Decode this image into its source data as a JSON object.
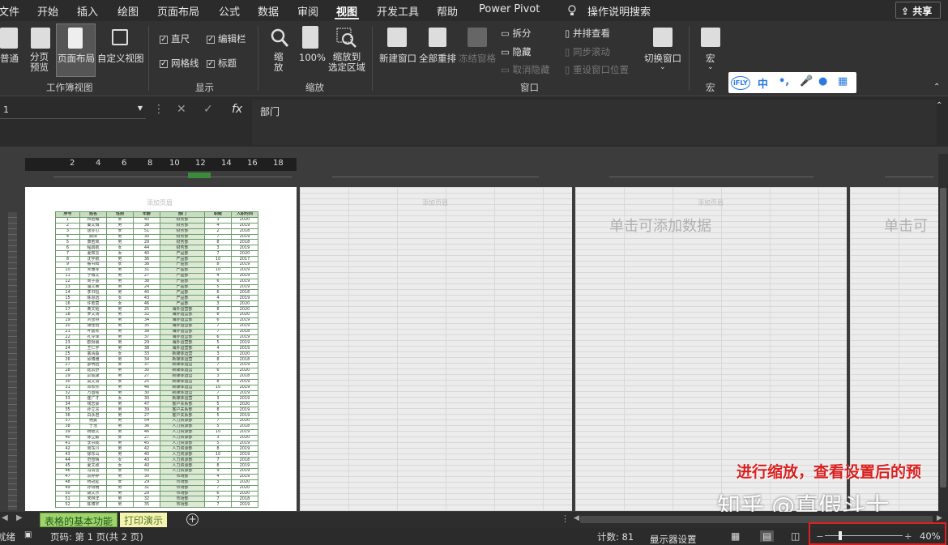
{
  "menu": {
    "items": [
      "文件",
      "开始",
      "插入",
      "绘图",
      "页面布局",
      "公式",
      "数据",
      "审阅",
      "视图",
      "开发工具",
      "帮助",
      "Power Pivot",
      "操作说明搜索"
    ],
    "active": "视图",
    "share": "共享"
  },
  "ribbon": {
    "workbook_views": {
      "label": "工作簿视图",
      "normal": "普通",
      "page_break": "分页\n预览",
      "page_layout": "页面布局",
      "custom": "自定义视图"
    },
    "show": {
      "label": "显示",
      "ruler": "直尺",
      "formula_bar": "编辑栏",
      "gridlines": "网格线",
      "headings": "标题"
    },
    "zoom": {
      "label": "缩放",
      "zoom": "缩\n放",
      "hundred": "100%",
      "selection": "缩放到\n选定区域"
    },
    "window": {
      "label": "窗口",
      "new_window": "新建窗口",
      "arrange_all": "全部重排",
      "freeze": "冻结窗格",
      "split": "拆分",
      "hide": "隐藏",
      "unhide": "取消隐藏",
      "side_by_side": "并排查看",
      "sync_scroll": "同步滚动",
      "reset_pos": "重设窗口位置",
      "switch": "切换窗口"
    },
    "macros": {
      "label": "宏",
      "macro": "宏"
    },
    "ifly": {
      "logo": "iFLY",
      "zh": "中"
    }
  },
  "formula_bar": {
    "cancel": "✕",
    "enter": "✓",
    "fx": "fx",
    "value": "部门"
  },
  "ruler": {
    "ticks": [
      "2",
      "4",
      "6",
      "8",
      "10",
      "12",
      "14",
      "16",
      "18"
    ]
  },
  "pages": {
    "header_hint": "添加页眉",
    "click_add": "单击可添加数据",
    "click_add_cut": "单击可"
  },
  "table": {
    "headers": [
      "序号",
      "姓名",
      "性别",
      "年龄",
      "部门",
      "职级",
      "入职时间"
    ],
    "rows": [
      [
        "1",
        "林若曦",
        "女",
        "40",
        "财务部",
        "3",
        "2020"
      ],
      [
        "2",
        "秦文博",
        "男",
        "38",
        "财务部",
        "4",
        "2019"
      ],
      [
        "3",
        "唐亦心",
        "女",
        "51",
        "财务部",
        "2",
        "2018"
      ],
      [
        "4",
        "顾泽",
        "男",
        "30",
        "财务部",
        "7",
        "2019"
      ],
      [
        "5",
        "萧若岚",
        "男",
        "29",
        "财务部",
        "8",
        "2018"
      ],
      [
        "6",
        "程启航",
        "女",
        "44",
        "财务部",
        "3",
        "2019"
      ],
      [
        "7",
        "夏知言",
        "女",
        "40",
        "产品部",
        "7",
        "2020"
      ],
      [
        "8",
        "沈宇航",
        "男",
        "36",
        "产品部",
        "10",
        "2017"
      ],
      [
        "9",
        "殷书阳",
        "女",
        "38",
        "产品部",
        "8",
        "2019"
      ],
      [
        "10",
        "宋雅琴",
        "男",
        "31",
        "产品部",
        "10",
        "2019"
      ],
      [
        "11",
        "于博文",
        "男",
        "27",
        "产品部",
        "4",
        "2019"
      ],
      [
        "12",
        "周子墨",
        "男",
        "38",
        "产品部",
        "6",
        "2019"
      ],
      [
        "13",
        "温文睿",
        "男",
        "24",
        "产品部",
        "5",
        "2019"
      ],
      [
        "14",
        "李书恒",
        "男",
        "40",
        "产品部",
        "6",
        "2018"
      ],
      [
        "15",
        "陈思远",
        "女",
        "43",
        "产品部",
        "4",
        "2019"
      ],
      [
        "16",
        "许若萱",
        "女",
        "46",
        "产品部",
        "3",
        "2020"
      ],
      [
        "17",
        "黄文韬",
        "男",
        "25",
        "海外运营部",
        "8",
        "2020"
      ],
      [
        "18",
        "罗文涛",
        "男",
        "32",
        "海外运营部",
        "8",
        "2020"
      ],
      [
        "19",
        "刘雪燕",
        "男",
        "34",
        "海外运营部",
        "6",
        "2019"
      ],
      [
        "20",
        "谭佳怡",
        "男",
        "35",
        "海外运营部",
        "7",
        "2019"
      ],
      [
        "21",
        "叶嘉欣",
        "男",
        "38",
        "海外运营部",
        "7",
        "2018"
      ],
      [
        "22",
        "孔令泽",
        "男",
        "37",
        "海外运营部",
        "6",
        "2019"
      ],
      [
        "23",
        "欧阳晨",
        "男",
        "29",
        "海外运营部",
        "5",
        "2019"
      ],
      [
        "24",
        "王仁宇",
        "男",
        "38",
        "海外运营部",
        "4",
        "2019"
      ],
      [
        "25",
        "裴清淼",
        "女",
        "33",
        "新媒体运营",
        "3",
        "2020"
      ],
      [
        "26",
        "邱博雅",
        "男",
        "34",
        "新媒体运营",
        "8",
        "2018"
      ],
      [
        "27",
        "邵明远",
        "女",
        "37",
        "新媒体运营",
        "7",
        "2019"
      ],
      [
        "28",
        "陆云舒",
        "男",
        "30",
        "新媒体运营",
        "6",
        "2020"
      ],
      [
        "29",
        "彭成康",
        "男",
        "27",
        "新媒体运营",
        "3",
        "2018"
      ],
      [
        "30",
        "莫文清",
        "女",
        "25",
        "新媒体运营",
        "8",
        "2019"
      ],
      [
        "31",
        "邓欣然",
        "男",
        "46",
        "新媒体运营",
        "10",
        "2019"
      ],
      [
        "32",
        "方国强",
        "男",
        "30",
        "新媒体运营",
        "7",
        "2019"
      ],
      [
        "33",
        "崔广才",
        "女",
        "30",
        "新媒体运营",
        "3",
        "2019"
      ],
      [
        "34",
        "钱志豪",
        "男",
        "47",
        "客户关系部",
        "5",
        "2020"
      ],
      [
        "35",
        "孙立言",
        "男",
        "39",
        "客户关系部",
        "8",
        "2019"
      ],
      [
        "36",
        "白永君",
        "男",
        "27",
        "客户关系部",
        "5",
        "2019"
      ],
      [
        "37",
        "杨勇",
        "男",
        "54",
        "人力资源部",
        "7",
        "2020"
      ],
      [
        "38",
        "于浩",
        "男",
        "36",
        "人力资源部",
        "5",
        "2018"
      ],
      [
        "39",
        "杨德文",
        "男",
        "46",
        "人力资源部",
        "10",
        "2019"
      ],
      [
        "40",
        "徐立毅",
        "女",
        "27",
        "人力资源部",
        "3",
        "2020"
      ],
      [
        "41",
        "李书成",
        "男",
        "45",
        "人力资源部",
        "5",
        "2019"
      ],
      [
        "42",
        "周东川",
        "男",
        "42",
        "人力资源部",
        "8",
        "2019"
      ],
      [
        "43",
        "徐东山",
        "男",
        "40",
        "人力资源部",
        "10",
        "2019"
      ],
      [
        "44",
        "范雪晴",
        "女",
        "43",
        "人力资源部",
        "7",
        "2018"
      ],
      [
        "45",
        "夏文政",
        "女",
        "40",
        "人力资源部",
        "8",
        "2019"
      ],
      [
        "46",
        "冯清洁",
        "女",
        "50",
        "人力资源部",
        "9",
        "2019"
      ],
      [
        "47",
        "袁婷婷",
        "男",
        "30",
        "市场部",
        "4",
        "2019"
      ],
      [
        "48",
        "杨冠星",
        "女",
        "29",
        "市场部",
        "3",
        "2020"
      ],
      [
        "49",
        "孙诗雨",
        "男",
        "31",
        "市场部",
        "7",
        "2020"
      ],
      [
        "50",
        "胡文乐",
        "男",
        "29",
        "市场部",
        "6",
        "2020"
      ],
      [
        "51",
        "宋林洋",
        "男",
        "32",
        "市场部",
        "7",
        "2018"
      ],
      [
        "52",
        "陈博宇",
        "男",
        "35",
        "市场部",
        "7",
        "2019"
      ]
    ]
  },
  "sheet_tabs": {
    "active": "表格的基本功能",
    "inactive": "打印演示",
    "add": "+"
  },
  "status": {
    "ready": "就绪",
    "page_info": "页码: 第 1 页(共 2 页)",
    "count": "计数: 81",
    "display_settings": "显示器设置",
    "zoom_minus": "−",
    "zoom_plus": "+",
    "zoom": "40%",
    "zoom_level_percent": 40
  },
  "annotation": "进行缩放，查看设置后的预",
  "watermark": "知乎 @真假斗士",
  "colors": {
    "accent_tab": "#9fd46a",
    "annotation": "#d82020",
    "table_header": "#c8dcc0"
  }
}
